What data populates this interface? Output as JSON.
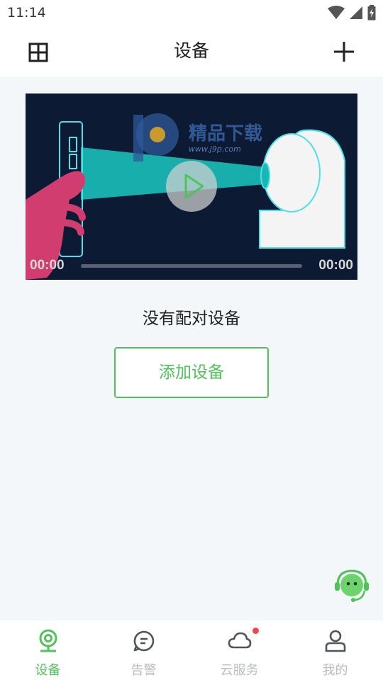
{
  "status_bar": {
    "time": "11:14"
  },
  "header": {
    "title": "设备"
  },
  "video": {
    "current_time": "00:00",
    "duration": "00:00",
    "watermark_text": "精品下载",
    "watermark_url": "www.j9p.com"
  },
  "main": {
    "empty_message": "没有配对设备",
    "add_button_label": "添加设备"
  },
  "tabs": [
    {
      "label": "设备",
      "icon": "camera-icon",
      "active": true
    },
    {
      "label": "告警",
      "icon": "message-icon",
      "active": false
    },
    {
      "label": "云服务",
      "icon": "cloud-icon",
      "active": false,
      "badge": true
    },
    {
      "label": "我的",
      "icon": "user-icon",
      "active": false
    }
  ],
  "colors": {
    "accent": "#4fc35a",
    "badge": "#f24848",
    "video_bg": "#0d1a33",
    "beam": "#19b6b3"
  }
}
